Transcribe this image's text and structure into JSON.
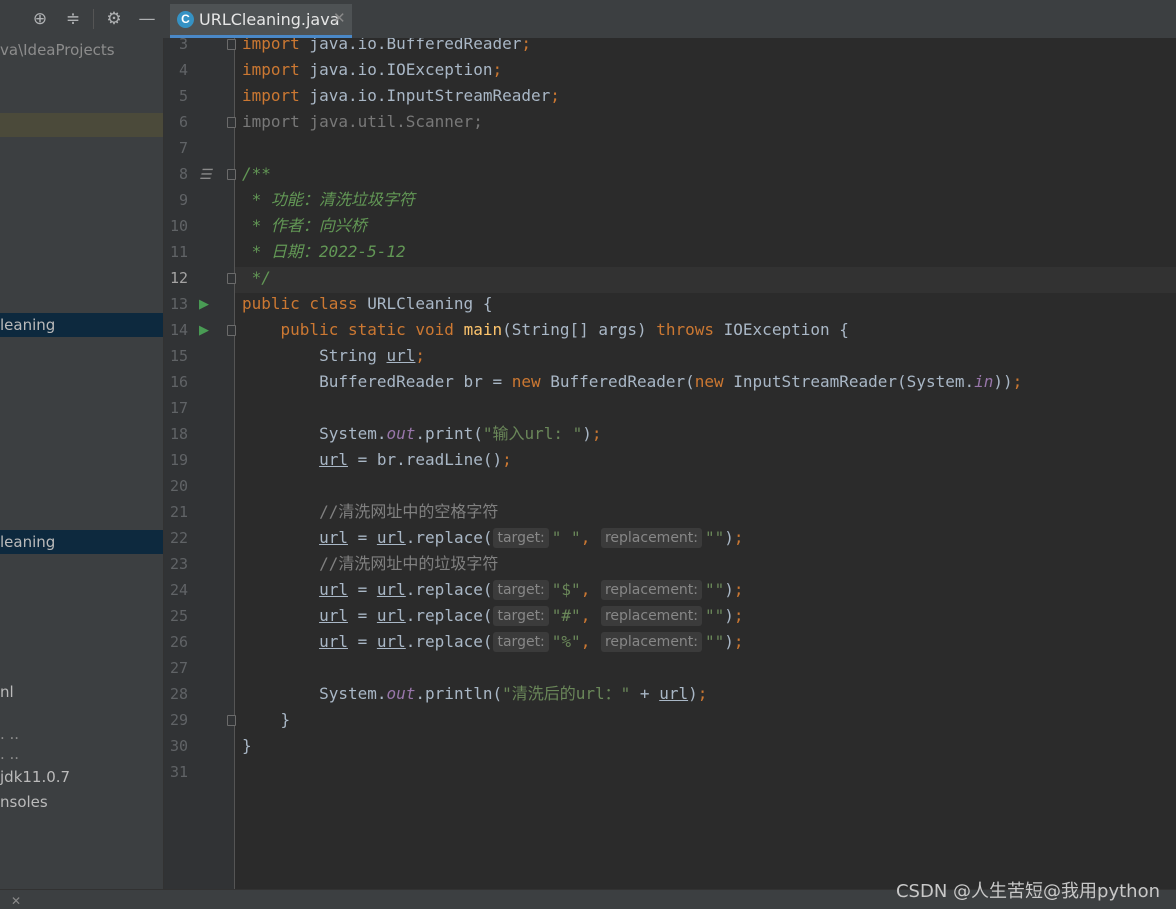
{
  "toolbar": {
    "locate_icon": "⊕",
    "collapse_icon": "≑",
    "settings_icon": "⚙",
    "hide_icon": "—"
  },
  "sidebar": {
    "items": [
      {
        "label": "va\\IdeaProjects"
      },
      {
        "label": "leaning"
      },
      {
        "label": "leaning"
      },
      {
        "label": "nl"
      },
      {
        "label": ". .."
      },
      {
        "label": ". .."
      },
      {
        "label": "jdk11.0.7"
      },
      {
        "label": "nsoles"
      }
    ]
  },
  "tab": {
    "icon_letter": "C",
    "label": "URLCleaning.java",
    "close": "✕"
  },
  "editor": {
    "current_line": "12",
    "lines": [
      {
        "n": "3",
        "t": [
          "import",
          " java.io.BufferedReader",
          ";"
        ]
      },
      {
        "n": "4",
        "t": [
          "import",
          " java.io.IOException",
          ";"
        ]
      },
      {
        "n": "5",
        "t": [
          "import",
          " java.io.InputStreamReader",
          ";"
        ]
      },
      {
        "n": "6",
        "t": [
          "import java.util.Scanner;"
        ]
      },
      {
        "n": "7",
        "t": []
      },
      {
        "n": "8",
        "t": [
          "/**"
        ]
      },
      {
        "n": "9",
        "t": [
          " * 功能：清洗垃圾字符"
        ]
      },
      {
        "n": "10",
        "t": [
          " * 作者：向兴桥"
        ]
      },
      {
        "n": "11",
        "t": [
          " * 日期：2022-5-12"
        ]
      },
      {
        "n": "12",
        "t": [
          " */"
        ]
      },
      {
        "n": "13",
        "t": [
          "public class",
          " URLCleaning {"
        ]
      },
      {
        "n": "14",
        "t": [
          "    public static void",
          " ",
          "main",
          "(String[] args) ",
          "throws",
          " IOException {"
        ]
      },
      {
        "n": "15",
        "t": [
          "        String ",
          "url",
          ";"
        ]
      },
      {
        "n": "16",
        "t": [
          "        BufferedReader br = ",
          "new",
          " BufferedReader(",
          "new",
          " InputStreamReader(System.",
          "in",
          "))",
          ";"
        ]
      },
      {
        "n": "17",
        "t": []
      },
      {
        "n": "18",
        "t": [
          "        System.",
          "out",
          ".print(",
          "\"输入url: \"",
          ")",
          ";"
        ]
      },
      {
        "n": "19",
        "t": [
          "        ",
          "url",
          " = br.readLine()",
          ";"
        ]
      },
      {
        "n": "20",
        "t": []
      },
      {
        "n": "21",
        "t": [
          "        //清洗网址中的空格字符"
        ]
      },
      {
        "n": "22",
        "t": [
          "        ",
          "url",
          " = ",
          "url",
          ".replace(",
          "target:",
          "\" \"",
          ", ",
          "replacement:",
          "\"\"",
          ")",
          ";"
        ]
      },
      {
        "n": "23",
        "t": [
          "        //清洗网址中的垃圾字符"
        ]
      },
      {
        "n": "24",
        "t": [
          "        ",
          "url",
          " = ",
          "url",
          ".replace(",
          "target:",
          "\"$\"",
          ", ",
          "replacement:",
          "\"\"",
          ")",
          ";"
        ]
      },
      {
        "n": "25",
        "t": [
          "        ",
          "url",
          " = ",
          "url",
          ".replace(",
          "target:",
          "\"#\"",
          ", ",
          "replacement:",
          "\"\"",
          ")",
          ";"
        ]
      },
      {
        "n": "26",
        "t": [
          "        ",
          "url",
          " = ",
          "url",
          ".replace(",
          "target:",
          "\"%\"",
          ", ",
          "replacement:",
          "\"\"",
          ")",
          ";"
        ]
      },
      {
        "n": "27",
        "t": []
      },
      {
        "n": "28",
        "t": [
          "        System.",
          "out",
          ".println(",
          "\"清洗后的url：\"",
          " + ",
          "url",
          ")",
          ";"
        ]
      },
      {
        "n": "29",
        "t": [
          "    }"
        ]
      },
      {
        "n": "30",
        "t": [
          "}"
        ]
      },
      {
        "n": "31",
        "t": []
      }
    ]
  },
  "gutter": {
    "run_icon": "▶",
    "doc_icon": "☰"
  },
  "statusbar": {
    "close": "✕"
  },
  "watermark": "CSDN @人生苦短@我用python",
  "colors": {
    "keyword": "#cc7832",
    "string": "#6a8759",
    "doc_comment": "#629755",
    "function": "#ffc66d",
    "static_field": "#9876aa",
    "selection": "#0d293e"
  }
}
